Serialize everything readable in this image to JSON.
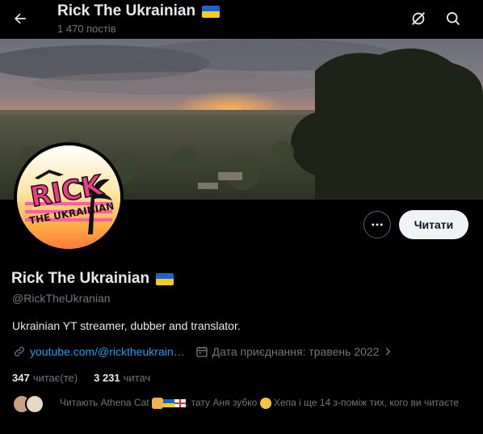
{
  "header": {
    "title": "Rick The Ukrainian",
    "posts_count": "1 470 постів"
  },
  "profile": {
    "name": "Rick The Ukrainian",
    "handle": "@RickTheUkranian",
    "bio": "Ukrainian YT streamer, dubber and translator.",
    "website": "youtube.com/@ricktheukrain…",
    "joined": "Дата приєднання: травень 2022",
    "following_count": "347",
    "following_label": "читає(те)",
    "followers_count": "3 231",
    "followers_label": "читач",
    "avatar_text_top": "RICK",
    "avatar_text_bottom": "THE UKRAINIAN"
  },
  "actions": {
    "follow_label": "Читати"
  },
  "followed_by": {
    "prefix": "Читають Athena Cat",
    "mid": ", тату Аня зубко",
    "suffix": " Хепа і ще 14 з-поміж тих, кого ви читаєте"
  },
  "colors": {
    "accent": "#1d9bf0",
    "background": "#000000",
    "muted": "#71767b",
    "text": "#e7e9ea"
  },
  "icons": [
    "back-arrow-icon",
    "grok-icon",
    "search-icon",
    "more-icon",
    "link-icon",
    "calendar-icon",
    "chevron-right-icon",
    "ukraine-flag-icon"
  ]
}
